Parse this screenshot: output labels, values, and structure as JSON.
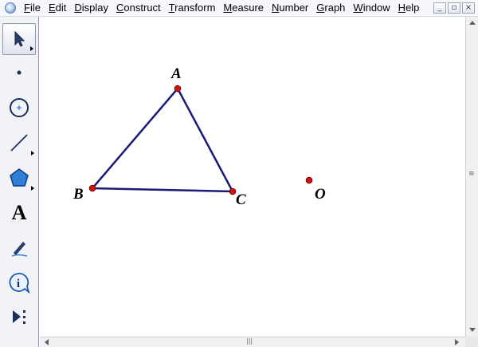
{
  "app": {
    "icon": "sketchpad-app-icon"
  },
  "menubar": {
    "items": [
      {
        "underline": "F",
        "rest": "ile"
      },
      {
        "underline": "E",
        "rest": "dit"
      },
      {
        "underline": "D",
        "rest": "isplay"
      },
      {
        "underline": "C",
        "rest": "onstruct"
      },
      {
        "underline": "T",
        "rest": "ransform"
      },
      {
        "underline": "M",
        "rest": "easure"
      },
      {
        "underline": "N",
        "rest": "umber"
      },
      {
        "underline": "G",
        "rest": "raph"
      },
      {
        "underline": "W",
        "rest": "indow"
      },
      {
        "underline": "H",
        "rest": "elp"
      }
    ],
    "window_buttons": {
      "minimize": "_",
      "restore": "▫",
      "close": "×"
    }
  },
  "toolbox": {
    "tools": [
      {
        "name": "arrow-select-icon",
        "selected": true
      },
      {
        "name": "point-icon"
      },
      {
        "name": "compass-circle-icon"
      },
      {
        "name": "straightedge-icon"
      },
      {
        "name": "polygon-icon"
      },
      {
        "name": "text-icon",
        "glyph": "A"
      },
      {
        "name": "marker-icon"
      },
      {
        "name": "information-icon",
        "glyph": "i"
      },
      {
        "name": "custom-tools-icon"
      }
    ]
  },
  "canvas": {
    "colors": {
      "segment": "#1a1a7a",
      "point_fill": "#d01414",
      "point_stroke": "#7a0000"
    },
    "points": {
      "A": {
        "label": "A"
      },
      "B": {
        "label": "B"
      },
      "C": {
        "label": "C"
      },
      "O": {
        "label": "O"
      }
    }
  },
  "scrollbars": {
    "grip_glyph": "≡",
    "hgrip_glyph": "|||"
  }
}
